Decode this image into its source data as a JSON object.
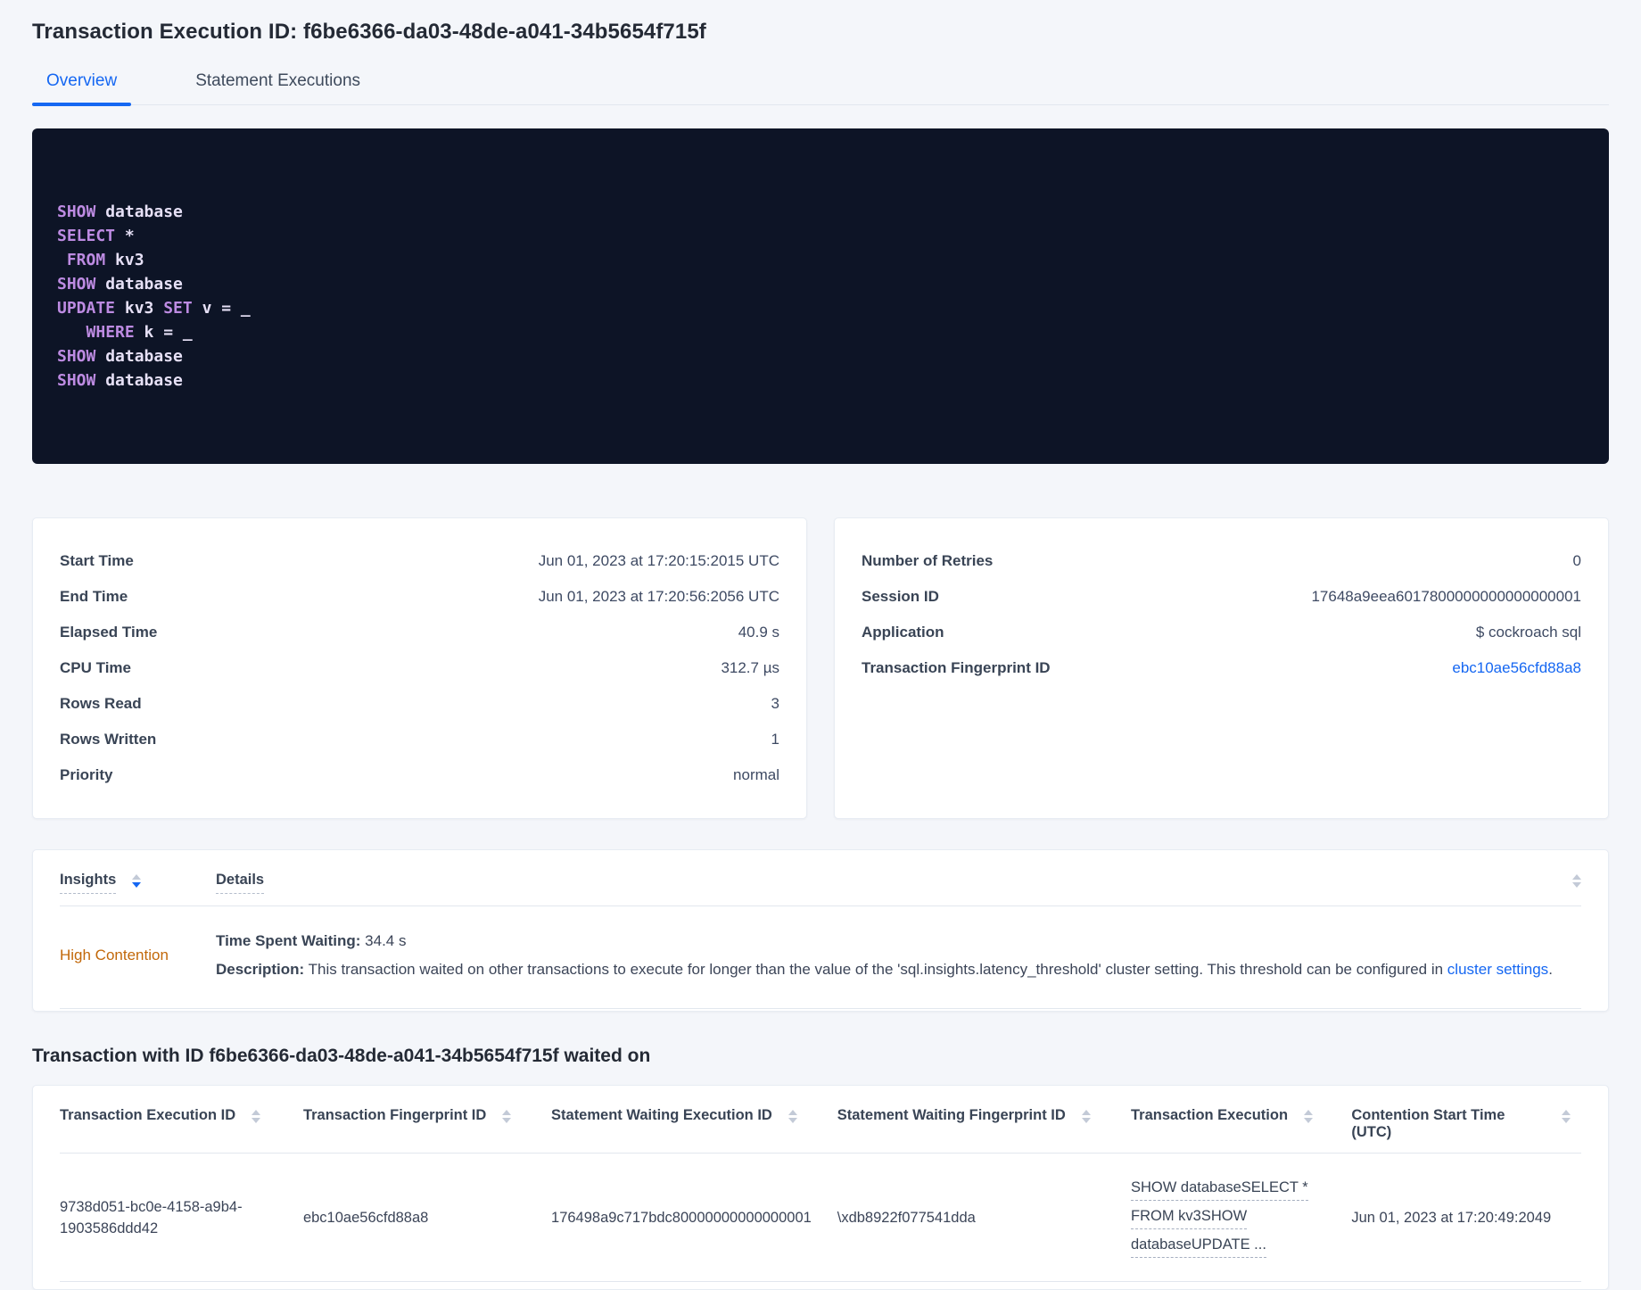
{
  "header": {
    "title": "Transaction Execution ID: f6be6366-da03-48de-a041-34b5654f715f",
    "tabs": [
      {
        "label": "Overview",
        "active": true
      },
      {
        "label": "Statement Executions",
        "active": false
      }
    ]
  },
  "sql": {
    "lines": [
      [
        {
          "t": "SHOW",
          "kw": true
        },
        {
          "t": " database"
        }
      ],
      [
        {
          "t": "SELECT",
          "kw": true
        },
        {
          "t": " *"
        }
      ],
      [
        {
          "t": " "
        },
        {
          "t": "FROM",
          "kw": true
        },
        {
          "t": " kv3"
        }
      ],
      [
        {
          "t": "SHOW",
          "kw": true
        },
        {
          "t": " database"
        }
      ],
      [
        {
          "t": "UPDATE",
          "kw": true
        },
        {
          "t": " kv3 "
        },
        {
          "t": "SET",
          "kw": true
        },
        {
          "t": " v = _"
        }
      ],
      [
        {
          "t": "   "
        },
        {
          "t": "WHERE",
          "kw": true
        },
        {
          "t": " k = _"
        }
      ],
      [
        {
          "t": "SHOW",
          "kw": true
        },
        {
          "t": " database"
        }
      ],
      [
        {
          "t": "SHOW",
          "kw": true
        },
        {
          "t": " database"
        }
      ]
    ]
  },
  "details": {
    "left": {
      "rows": [
        {
          "label": "Start Time",
          "value": "Jun 01, 2023 at 17:20:15:2015 UTC"
        },
        {
          "label": "End Time",
          "value": "Jun 01, 2023 at 17:20:56:2056 UTC"
        },
        {
          "label": "Elapsed Time",
          "value": "40.9 s"
        },
        {
          "label": "CPU Time",
          "value": "312.7 µs"
        },
        {
          "label": "Rows Read",
          "value": "3"
        },
        {
          "label": "Rows Written",
          "value": "1"
        },
        {
          "label": "Priority",
          "value": "normal"
        }
      ]
    },
    "right": {
      "rows": [
        {
          "label": "Number of Retries",
          "value": "0"
        },
        {
          "label": "Session ID",
          "value": "17648a9eea6017800000000000000001"
        },
        {
          "label": "Application",
          "value": "$ cockroach sql"
        }
      ],
      "fingerprint": {
        "label": "Transaction Fingerprint ID",
        "value": "ebc10ae56cfd88a8"
      }
    }
  },
  "insights": {
    "insights_header": "Insights",
    "details_header": "Details",
    "row": {
      "insight": "High Contention",
      "waiting_label": "Time Spent Waiting:",
      "waiting_value": " 34.4 s",
      "desc_label": "Description:",
      "desc_text": " This transaction waited on other transactions to execute for longer than the value of the 'sql.insights.latency_threshold' cluster setting. This threshold can be configured in ",
      "desc_link": "cluster settings",
      "desc_end": "."
    }
  },
  "waited_on": {
    "title": "Transaction with ID f6be6366-da03-48de-a041-34b5654f715f waited on",
    "columns": [
      "Transaction Execution ID",
      "Transaction Fingerprint ID",
      "Statement Waiting Execution ID",
      "Statement Waiting Fingerprint ID",
      "Transaction Execution",
      "Contention Start Time (UTC)"
    ],
    "row": {
      "txn_execution_id": "9738d051-bc0e-4158-a9b4-1903586ddd42",
      "txn_fingerprint_id": "ebc10ae56cfd88a8",
      "stmt_waiting_execution_id": "176498a9c717bdc80000000000000001",
      "stmt_waiting_fingerprint_id": "\\xdb8922f077541dda",
      "txn_execution_lines": [
        "SHOW databaseSELECT *",
        "FROM kv3SHOW",
        "databaseUPDATE ..."
      ],
      "contention_start": "Jun 01, 2023 at 17:20:49:2049"
    }
  },
  "colors": {
    "accent_blue": "#1567f2",
    "insight_orange": "#c26809",
    "code_background": "#0d1426",
    "code_keyword": "#bd8be2",
    "code_text": "#e6e0f6",
    "page_background": "#f4f6fa"
  }
}
